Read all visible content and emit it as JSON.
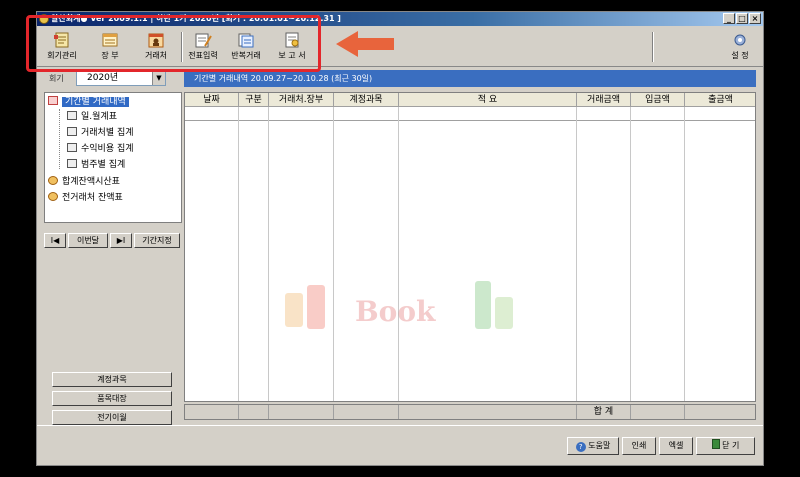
{
  "window": {
    "title": "알찬회계● Ver 2009.1.1 | 하반 1기 2020년 [회기 : 20.01.01~20.12.31 ]",
    "controls": [
      "_",
      "□",
      "×"
    ]
  },
  "toolbar": {
    "items": [
      {
        "label": "회기관리",
        "icon": "ledger-icon"
      },
      {
        "label": "장 부",
        "icon": "book-icon"
      },
      {
        "label": "거래처",
        "icon": "contact-card-icon"
      },
      {
        "label": "전표입력",
        "icon": "voucher-edit-icon"
      },
      {
        "label": "반복거래",
        "icon": "repeat-doc-icon"
      },
      {
        "label": "보 고 서",
        "icon": "report-icon"
      }
    ],
    "settings_label": "설 정"
  },
  "sidebar": {
    "year_label": "회기",
    "year_value": "2020년",
    "tree": [
      {
        "label": "기간별 거래내역",
        "level": 0,
        "selected": true
      },
      {
        "label": "일.월계표",
        "level": 1
      },
      {
        "label": "거래처별 집계",
        "level": 1
      },
      {
        "label": "수익비용 집계",
        "level": 1
      },
      {
        "label": "범주별 집계",
        "level": 1
      },
      {
        "label": "합계잔액시산표",
        "level": 0
      },
      {
        "label": "전거래처 잔액표",
        "level": 0
      }
    ],
    "nav": {
      "first": "I◀",
      "prev_label": "이번달",
      "next": "▶I",
      "range_label": "기간지정"
    },
    "buttons": [
      "계정과목",
      "품목대장",
      "전기이월"
    ]
  },
  "main": {
    "header": "기간별 거래내역  20.09.27~20.10.28 (최근 30일)",
    "columns": [
      "날짜",
      "구분",
      "거래처.장부",
      "계정과목",
      "적 요",
      "거래금액",
      "입금액",
      "출금액"
    ],
    "total_label": "합 계",
    "watermark": "Book"
  },
  "bottom": {
    "help": "도움말",
    "print": "인쇄",
    "excel": "엑셀",
    "close": "닫 기"
  },
  "colors": {
    "highlight": "#e3262b",
    "header_blue": "#3a6ec0",
    "window_bg": "#d4d0c8"
  }
}
